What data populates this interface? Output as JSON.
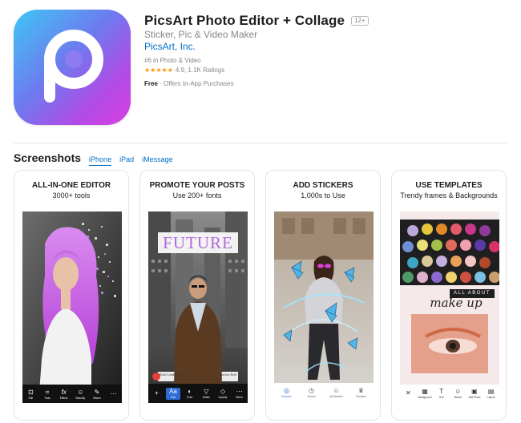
{
  "app": {
    "title": "PicsArt Photo Editor + Collage",
    "age_rating": "12+",
    "subtitle": "Sticker, Pic & Video Maker",
    "developer": "PicsArt, Inc.",
    "rank": "#6 in Photo & Video",
    "stars_display": "★★★★★",
    "rating": "4.9, 1.1K Ratings",
    "price": "Free",
    "purchase_note": "· Offers In-App Purchases"
  },
  "screenshots": {
    "title": "Screenshots",
    "tabs": [
      {
        "label": "iPhone",
        "active": true
      },
      {
        "label": "iPad",
        "active": false
      },
      {
        "label": "iMessage",
        "active": false
      }
    ],
    "cards": [
      {
        "title": "ALL-IN-ONE EDITOR",
        "caption": "3000+ tools",
        "toolbar": [
          {
            "icon": "crop-icon",
            "glyph": "⊡",
            "label": "Edit"
          },
          {
            "icon": "tools-icon",
            "glyph": "⌗",
            "label": "Tools"
          },
          {
            "icon": "effects-icon",
            "glyph": "fx",
            "label": "Effects"
          },
          {
            "icon": "beautify-icon",
            "glyph": "☺",
            "label": "Beautify"
          },
          {
            "icon": "sticker-icon",
            "glyph": "✎",
            "label": "Sticker"
          },
          {
            "icon": "more-icon",
            "glyph": "⋯",
            "label": ""
          }
        ]
      },
      {
        "title": "PROMOTE YOUR POSTS",
        "caption": "Use 200+ fonts",
        "overlay_text": "FUTURE",
        "bottom_text_left": "Bold Condensed",
        "bottom_text_right": "Sanchez Bold",
        "toolbar": [
          {
            "icon": "add-icon",
            "glyph": "+",
            "label": ""
          },
          {
            "icon": "font-icon",
            "glyph": "Aa",
            "label": "Font"
          },
          {
            "icon": "color-icon",
            "glyph": "◐",
            "label": "Color"
          },
          {
            "icon": "stroke-icon",
            "glyph": "▽",
            "label": "Stroke"
          },
          {
            "icon": "opacity-icon",
            "glyph": "◇",
            "label": "Opacity"
          },
          {
            "icon": "more-icon",
            "glyph": "⋯",
            "label": "Blend"
          }
        ]
      },
      {
        "title": "ADD STICKERS",
        "caption": "1,000s to Use",
        "toolbar": [
          {
            "icon": "discover-icon",
            "glyph": "◎",
            "label": "Discover"
          },
          {
            "icon": "recent-icon",
            "glyph": "◷",
            "label": "Recent"
          },
          {
            "icon": "my-stickers-icon",
            "glyph": "☺",
            "label": "My Stickers"
          },
          {
            "icon": "premium-icon",
            "glyph": "♛",
            "label": "Premium"
          }
        ]
      },
      {
        "title": "USE TEMPLATES",
        "caption": "Trendy frames & Backgrounds",
        "overlay_banner": "ALL ABOUT",
        "overlay_script": "make up",
        "toolbar": [
          {
            "icon": "close-icon",
            "glyph": "✕",
            "label": ""
          },
          {
            "icon": "background-icon",
            "glyph": "▦",
            "label": "Background"
          },
          {
            "icon": "text-icon",
            "glyph": "T",
            "label": "Text"
          },
          {
            "icon": "sticker-icon",
            "glyph": "☺",
            "label": "Sticker"
          },
          {
            "icon": "add-photo-icon",
            "glyph": "▣",
            "label": "Add Photo"
          },
          {
            "icon": "layout-icon",
            "glyph": "▤",
            "label": "Layout"
          }
        ]
      }
    ]
  },
  "colors": {
    "link": "#0070c9",
    "star": "#ff9500",
    "muted": "#86868b",
    "icon_gradient_start": "#3ec7f5",
    "icon_gradient_end": "#d83fe0"
  }
}
